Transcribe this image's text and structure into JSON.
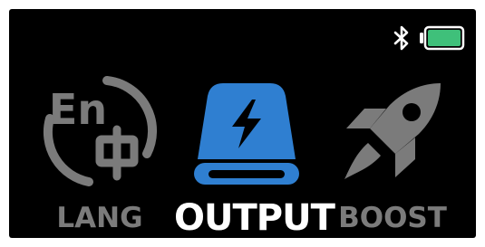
{
  "status_bar": {
    "bluetooth_icon": "bluetooth-icon",
    "battery_icon": "battery-full-icon",
    "battery_color": "#3fc07a"
  },
  "menu": {
    "items": [
      {
        "label": "LANG",
        "icon": "language-en-zh-icon",
        "selected": false
      },
      {
        "label": "OUTPUT",
        "icon": "output-lightning-icon",
        "selected": true
      },
      {
        "label": "BOOST",
        "icon": "rocket-icon",
        "selected": false
      }
    ]
  },
  "colors": {
    "background": "#000000",
    "active_label": "#ffffff",
    "inactive": "#7b7b7b",
    "accent": "#2f7fd1"
  }
}
